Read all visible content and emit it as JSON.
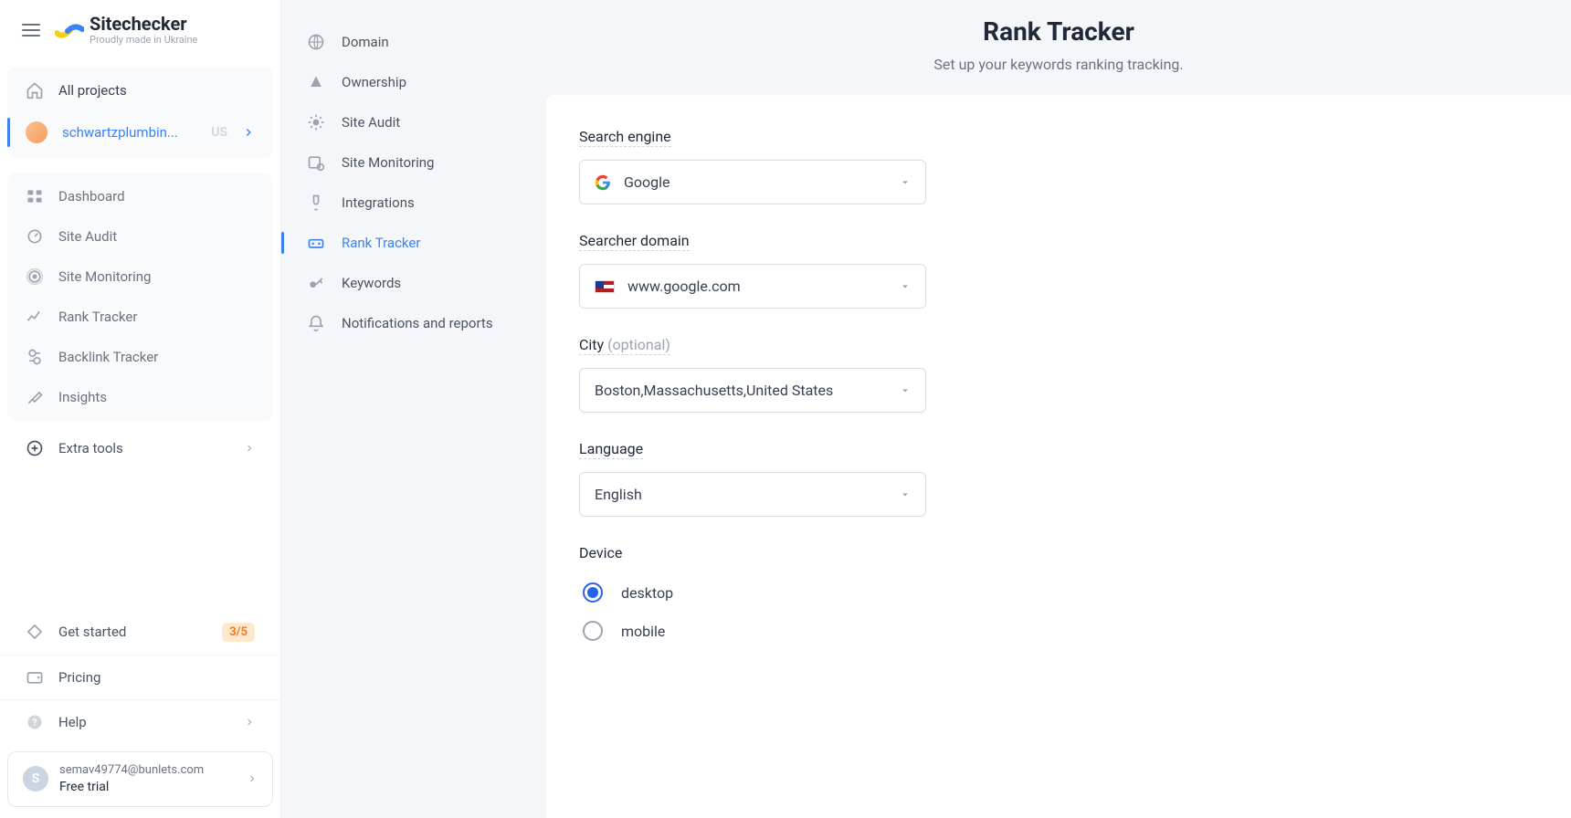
{
  "brand": {
    "title": "Sitechecker",
    "sub": "Proudly made in Ukraine"
  },
  "left": {
    "all_projects": "All projects",
    "project": {
      "name": "schwartzplumbin...",
      "country": "US"
    },
    "items": [
      "Dashboard",
      "Site Audit",
      "Site Monitoring",
      "Rank Tracker",
      "Backlink Tracker",
      "Insights"
    ],
    "extra": "Extra tools",
    "get_started": {
      "label": "Get started",
      "badge": "3/5"
    },
    "pricing": "Pricing",
    "help": "Help",
    "user": {
      "initial": "S",
      "email": "semav49774@bunlets.com",
      "plan": "Free trial"
    }
  },
  "mid": {
    "items": [
      "Domain",
      "Ownership",
      "Site Audit",
      "Site Monitoring",
      "Integrations",
      "Rank Tracker",
      "Keywords",
      "Notifications and reports"
    ],
    "active_index": 5
  },
  "header": {
    "title": "Rank Tracker",
    "subtitle": "Set up your keywords ranking tracking."
  },
  "form": {
    "search_engine": {
      "label": "Search engine",
      "value": "Google"
    },
    "domain": {
      "label": "Searcher domain",
      "value": "www.google.com"
    },
    "city": {
      "label": "City",
      "optional": "(optional)",
      "value": "Boston,Massachusetts,United States"
    },
    "language": {
      "label": "Language",
      "value": "English"
    },
    "device": {
      "label": "Device",
      "options": [
        "desktop",
        "mobile"
      ],
      "selected": "desktop"
    }
  }
}
